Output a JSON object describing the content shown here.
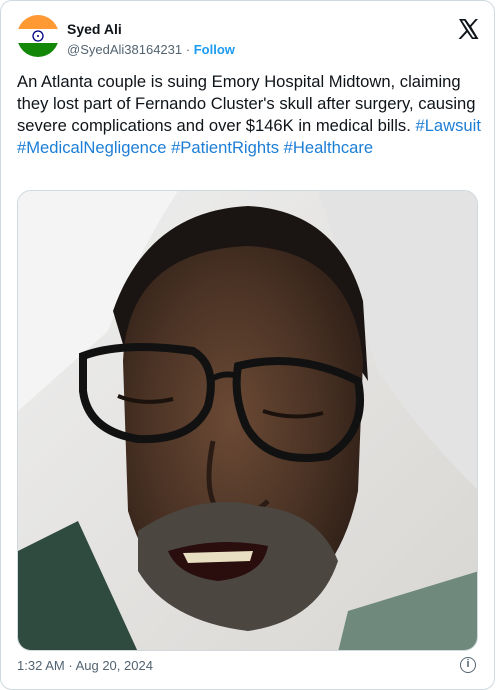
{
  "author": {
    "name": "Syed Ali",
    "handle": "@SyedAli38164231",
    "separator": "·",
    "follow_label": "Follow",
    "avatar_icon": "india-flag-icon"
  },
  "platform_icon": "x-logo-icon",
  "tweet": {
    "body": "An Atlanta couple is suing Emory Hospital Midtown, claiming they lost part of Fernando Cluster's skull after surgery, causing severe complications and over $146K in medical bills.",
    "hashtags": [
      "#Lawsuit",
      "#MedicalNegligence",
      "#PatientRights",
      "#Healthcare"
    ]
  },
  "media": {
    "subject": "man-lying-in-hospital-bed-photo"
  },
  "footer": {
    "time": "1:32 AM",
    "separator": "·",
    "date": "Aug 20, 2024",
    "info_icon": "info-icon",
    "info_glyph": "i"
  },
  "colors": {
    "link": "#1d9bf0",
    "hashtag": "#1d7ed6",
    "saffron": "#ff9933",
    "green": "#138808",
    "chakra": "#000080"
  }
}
